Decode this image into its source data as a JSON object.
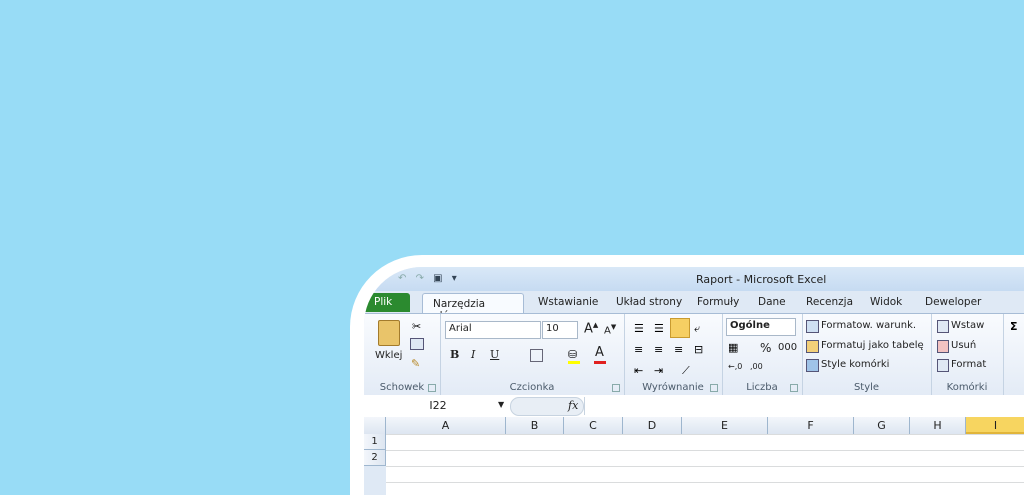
{
  "window": {
    "title": "Raport - Microsoft Excel"
  },
  "qat": {
    "undo": "↶",
    "redo": "↷",
    "save": "▣",
    "more": "▾"
  },
  "tabs": {
    "file": "Plik",
    "active": "Narzędzia główne",
    "items": [
      "Wstawianie",
      "Układ strony",
      "Formuły",
      "Dane",
      "Recenzja",
      "Widok",
      "Deweloper"
    ]
  },
  "ribbon": {
    "clipboard": {
      "paste": "Wklej",
      "label": "Schowek"
    },
    "font": {
      "name": "Arial",
      "size": "10",
      "bold": "B",
      "italic": "I",
      "underline": "U",
      "label": "Czcionka"
    },
    "alignment": {
      "label": "Wyrównanie"
    },
    "number": {
      "format": "Ogólne",
      "percent": "%",
      "thousands": "000",
      "label": "Liczba"
    },
    "styles": {
      "conditional": "Formatow. warunk.",
      "table": "Formatuj jako tabelę",
      "cell": "Style komórki",
      "label": "Style"
    },
    "cells": {
      "insert": "Wstaw",
      "delete": "Usuń",
      "format": "Format",
      "label": "Komórki"
    }
  },
  "formula_bar": {
    "name_box": "I22",
    "fx": "fx",
    "value": ""
  },
  "sheet": {
    "columns": [
      "A",
      "B",
      "C",
      "D",
      "E",
      "F",
      "G",
      "H",
      "I"
    ],
    "selected_column": "I",
    "rows": [
      "1",
      "2"
    ]
  },
  "colors": {
    "background": "#98dcf6",
    "file_tab": "#2b8a2f",
    "selected_header": "#f7d560"
  }
}
